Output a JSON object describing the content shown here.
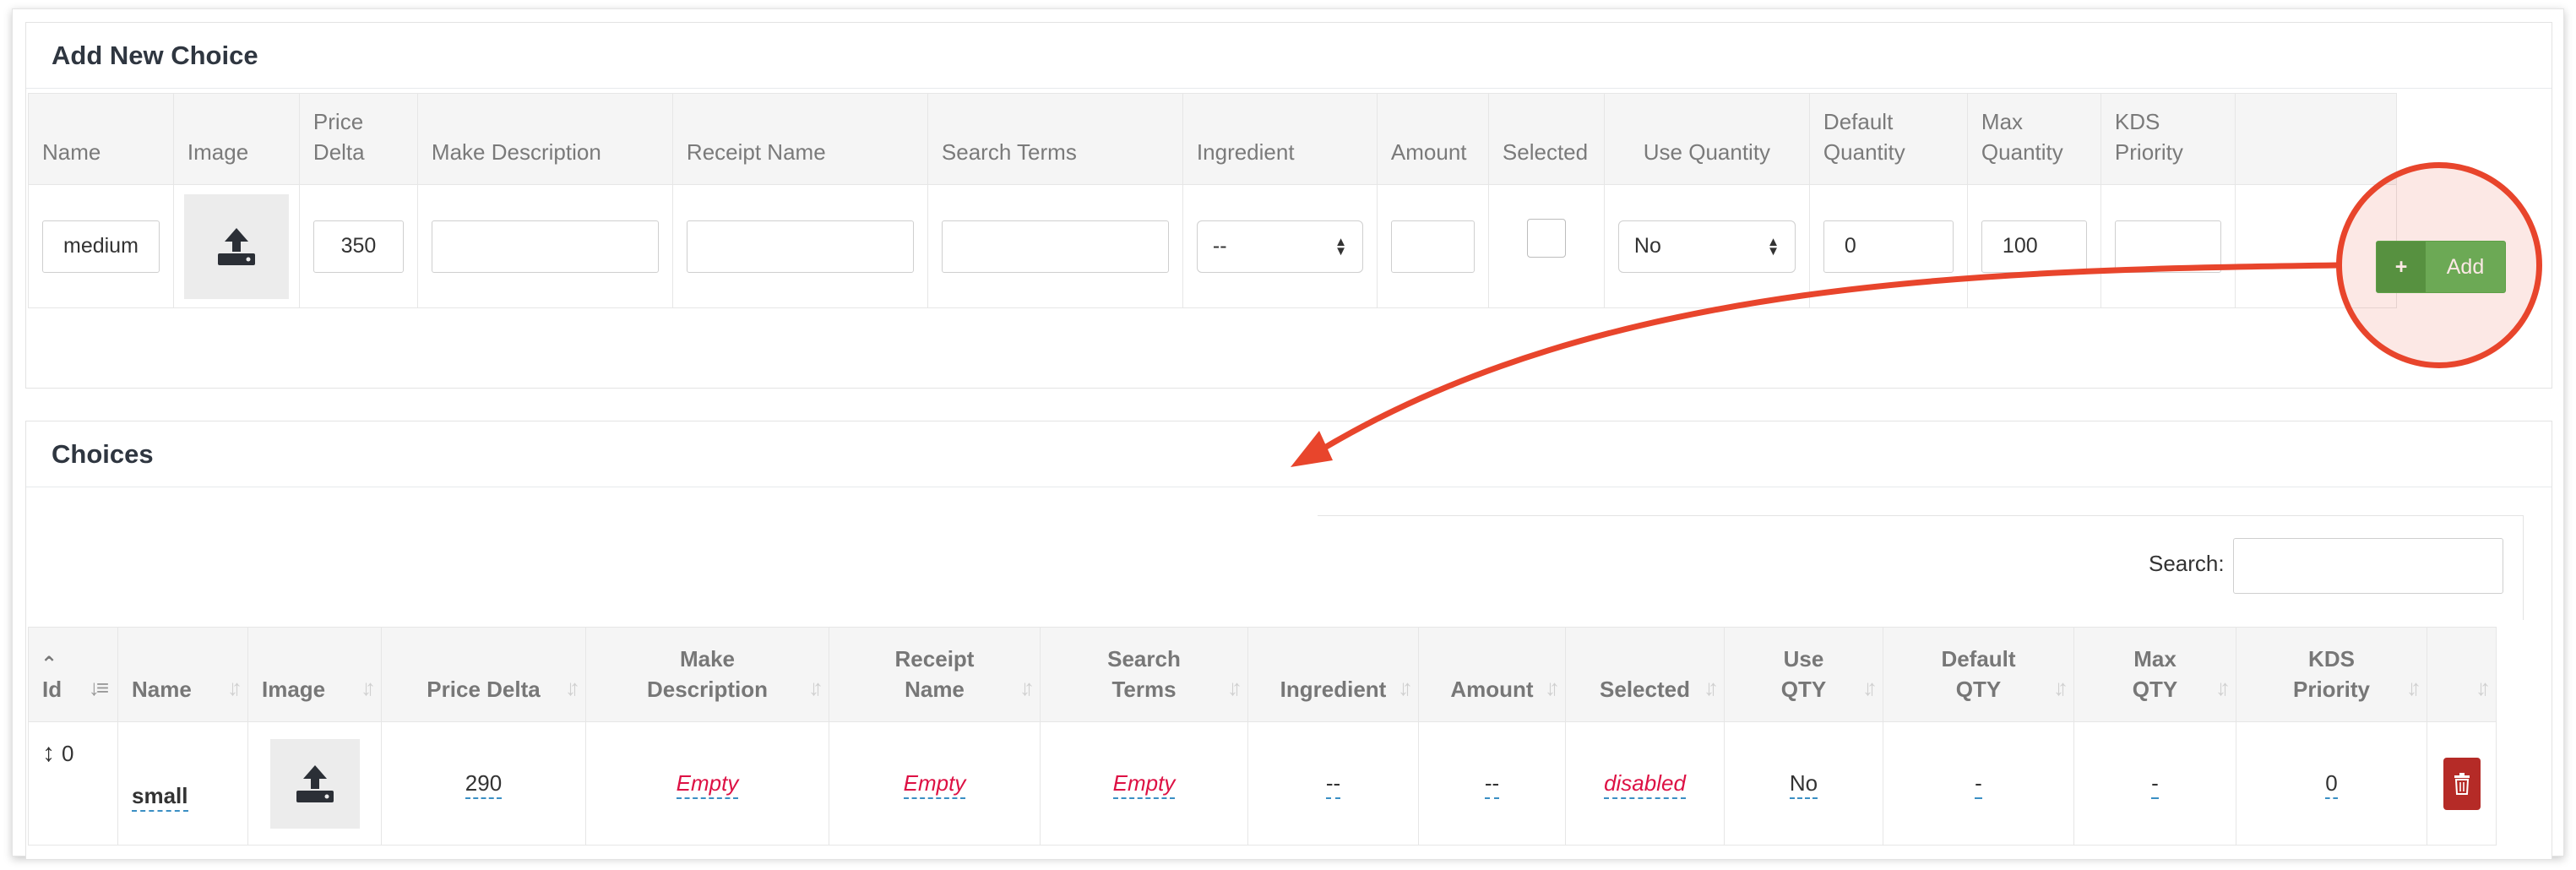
{
  "add_panel": {
    "title": "Add New Choice",
    "headers": [
      "Name",
      "Image",
      "Price Delta",
      "Make Description",
      "Receipt Name",
      "Search Terms",
      "Ingredient",
      "Amount",
      "Selected",
      "Use Quantity",
      "Default Quantity",
      "Max Quantity",
      "KDS Priority",
      ""
    ],
    "header_lines": {
      "price_delta": [
        "Price",
        "Delta"
      ],
      "default_quantity": [
        "Default",
        "Quantity"
      ],
      "max_quantity": [
        "Max",
        "Quantity"
      ],
      "kds_priority": [
        "KDS",
        "Priority"
      ]
    },
    "values": {
      "name": "medium",
      "price_delta": "350",
      "make_description": "",
      "receipt_name": "",
      "search_terms": "",
      "ingredient": "--",
      "amount": "",
      "use_quantity": "No",
      "default_quantity": "0",
      "max_quantity": "100",
      "kds_priority": ""
    },
    "add_button": {
      "icon": "+",
      "label": "Add"
    }
  },
  "choices_panel": {
    "title": "Choices",
    "search_label": "Search:",
    "search_value": "",
    "columns": {
      "id": "Id",
      "name": "Name",
      "image": "Image",
      "price_delta": "Price Delta",
      "make_description": [
        "Make",
        "Description"
      ],
      "receipt_name": [
        "Receipt",
        "Name"
      ],
      "search_terms": [
        "Search",
        "Terms"
      ],
      "ingredient": "Ingredient",
      "amount": "Amount",
      "selected": "Selected",
      "use_qty": [
        "Use",
        "QTY"
      ],
      "default_qty": [
        "Default",
        "QTY"
      ],
      "max_qty": [
        "Max",
        "QTY"
      ],
      "kds_priority": [
        "KDS",
        "Priority"
      ]
    },
    "rows": [
      {
        "id": "0",
        "name": "small",
        "price_delta": "290",
        "make_description": "Empty",
        "receipt_name": "Empty",
        "search_terms": "Empty",
        "ingredient": "--",
        "amount": "--",
        "selected": "disabled",
        "use_qty": "No",
        "default_qty": "-",
        "max_qty": "-",
        "kds_priority": "0"
      }
    ]
  },
  "annotation": {
    "accent_color": "#e8452c"
  },
  "colors": {
    "add_button": "#5cb85c",
    "delete_button": "#b52b27",
    "empty_text": "#dd1144",
    "editable_underline": "#3b8fc4"
  }
}
